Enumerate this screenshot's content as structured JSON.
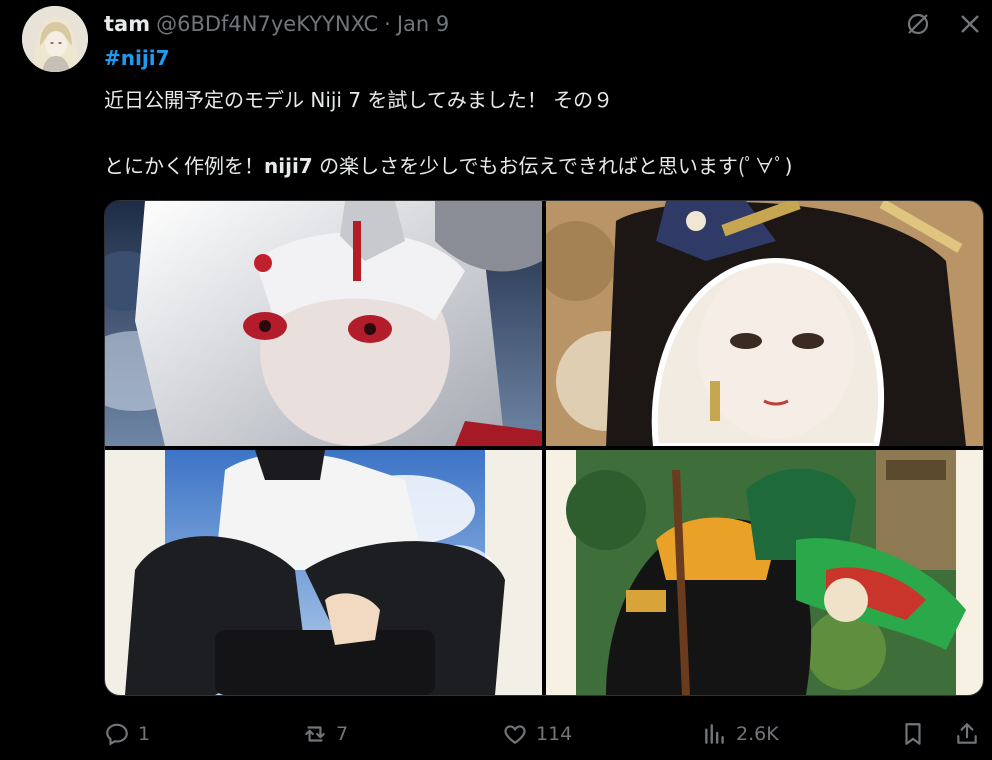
{
  "tweet": {
    "author_name": "tam",
    "handle": "@6BDf4N7yeKYYNXC",
    "separator": "·",
    "date": "Jan 9",
    "hashtag": "#niji7",
    "line1": "近日公開予定のモデル Niji 7 を試してみました！ その９",
    "line2_before": "とにかく作例を！",
    "line2_bold": "niji7",
    "line2_after": " の楽しさを少しでもお伝えできればと思います(ﾟ∀ﾟ)"
  },
  "media": [
    {
      "name": "silver-haired-girl-image"
    },
    {
      "name": "geisha-portrait-image"
    },
    {
      "name": "sitting-boy-image"
    },
    {
      "name": "rider-on-horse-image"
    }
  ],
  "actions": {
    "replies": "1",
    "reposts": "7",
    "likes": "114",
    "views": "2.6K"
  },
  "icons": [
    "grok-icon",
    "more-icon",
    "reply-icon",
    "repost-icon",
    "like-icon",
    "views-icon",
    "bookmark-icon",
    "share-icon"
  ],
  "colors": {
    "background": "#000000",
    "text": "#e7e9ea",
    "muted": "#71767b",
    "link": "#1d9bf0"
  }
}
